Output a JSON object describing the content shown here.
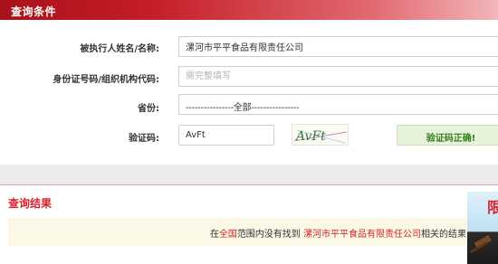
{
  "header": {
    "title": "查询条件"
  },
  "form": {
    "name_label": "被执行人姓名/名称:",
    "name_value": "漯河市平平食品有限责任公司",
    "id_label": "身份证号码/组织机构代码:",
    "id_placeholder": "需完整填写",
    "province_label": "省份:",
    "province_value": "----------------全部----------------",
    "captcha_label": "验证码:",
    "captcha_value": "AvFt",
    "captcha_image_text": "AvFt",
    "captcha_status": "验证码正确!"
  },
  "result": {
    "title": "查询结果",
    "msg_pre": "在",
    "msg_scope": "全国",
    "msg_mid": "范围内没有找到",
    "msg_company": "漯河市平平食品有限责任公司",
    "msg_post": "相关的结果"
  },
  "banner": {
    "text": "限"
  },
  "colors": {
    "brand_red": "#c41d26",
    "result_red": "#d4232c",
    "success_green": "#3a7d1e",
    "success_bg": "#e6f2da",
    "notice_bg": "#fcf8e6"
  }
}
